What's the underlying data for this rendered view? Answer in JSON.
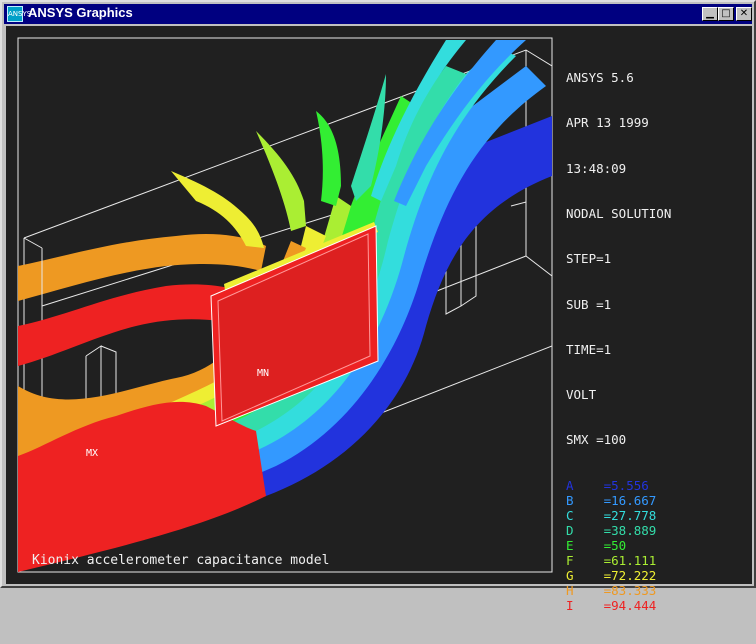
{
  "window": {
    "title": "ANSYS Graphics",
    "icon_label": "ANSYS",
    "controls": {
      "minimize": "minimize-icon",
      "maximize": "maximize-icon",
      "close": "close-icon"
    }
  },
  "legend": {
    "header": [
      "ANSYS 5.6",
      "APR 13 1999",
      "13:48:09",
      "NODAL SOLUTION",
      "STEP=1",
      "SUB =1",
      "TIME=1",
      "VOLT",
      "SMX =100"
    ],
    "contours": [
      {
        "letter": "A",
        "value": "=5.556",
        "color": "#2233dd"
      },
      {
        "letter": "B",
        "value": "=16.667",
        "color": "#3399ff"
      },
      {
        "letter": "C",
        "value": "=27.778",
        "color": "#33dddd"
      },
      {
        "letter": "D",
        "value": "=38.889",
        "color": "#33ddaa"
      },
      {
        "letter": "E",
        "value": "=50",
        "color": "#33ee33"
      },
      {
        "letter": "F",
        "value": "=61.111",
        "color": "#aaee33"
      },
      {
        "letter": "G",
        "value": "=72.222",
        "color": "#eeee33"
      },
      {
        "letter": "H",
        "value": "=83.333",
        "color": "#ee9922"
      },
      {
        "letter": "I",
        "value": "=94.444",
        "color": "#ee2222"
      }
    ]
  },
  "plot": {
    "min_label": "MN",
    "max_label": "MX",
    "caption": "Kionix accelerometer capacitance model"
  },
  "colors": {
    "titlebar": "#000080",
    "background": "#202020",
    "wireframe": "#e8e8e8"
  }
}
